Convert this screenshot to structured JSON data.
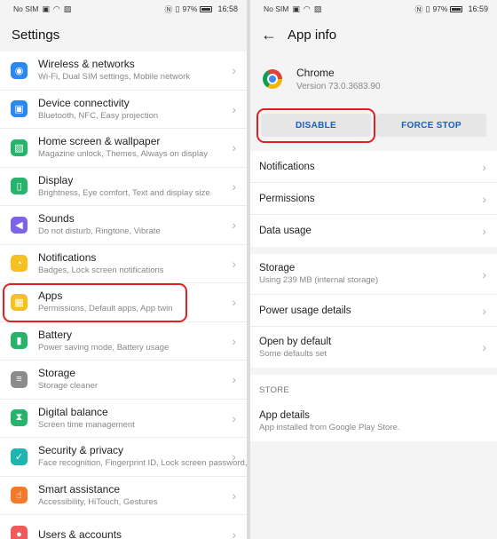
{
  "left": {
    "status": {
      "carrier": "No SIM",
      "battery": "97%",
      "time": "16:58"
    },
    "title": "Settings",
    "items": [
      {
        "title": "Wireless & networks",
        "sub": "Wi-Fi, Dual SIM settings, Mobile network",
        "icon": "wifi-icon",
        "glyph": "◉",
        "color": "#2b88ee"
      },
      {
        "title": "Device connectivity",
        "sub": "Bluetooth, NFC, Easy projection",
        "icon": "device-connectivity-icon",
        "glyph": "▣",
        "color": "#2b88ee"
      },
      {
        "title": "Home screen & wallpaper",
        "sub": "Magazine unlock, Themes, Always on display",
        "icon": "home-screen-icon",
        "glyph": "▧",
        "color": "#27b36b"
      },
      {
        "title": "Display",
        "sub": "Brightness, Eye comfort, Text and display size",
        "icon": "display-icon",
        "glyph": "▯",
        "color": "#27b36b"
      },
      {
        "title": "Sounds",
        "sub": "Do not disturb, Ringtone, Vibrate",
        "icon": "sound-icon",
        "glyph": "◀",
        "color": "#7e63e6"
      },
      {
        "title": "Notifications",
        "sub": "Badges, Lock screen notifications",
        "icon": "bell-icon",
        "glyph": "◔",
        "color": "#f5c021"
      },
      {
        "title": "Apps",
        "sub": "Permissions, Default apps, App twin",
        "icon": "apps-icon",
        "glyph": "▦",
        "color": "#f5c021"
      },
      {
        "title": "Battery",
        "sub": "Power saving mode, Battery usage",
        "icon": "battery-icon",
        "glyph": "▮",
        "color": "#27b36b"
      },
      {
        "title": "Storage",
        "sub": "Storage cleaner",
        "icon": "storage-icon",
        "glyph": "≡",
        "color": "#8c8c8c"
      },
      {
        "title": "Digital balance",
        "sub": "Screen time management",
        "icon": "hourglass-icon",
        "glyph": "⧗",
        "color": "#27b36b"
      },
      {
        "title": "Security & privacy",
        "sub": "Face recognition, Fingerprint ID, Lock screen password, Password vault",
        "icon": "shield-icon",
        "glyph": "✓",
        "color": "#1fb4b0"
      },
      {
        "title": "Smart assistance",
        "sub": "Accessibility, HiTouch, Gestures",
        "icon": "hand-icon",
        "glyph": "☝",
        "color": "#f5792a"
      },
      {
        "title": "Users & accounts",
        "sub": "",
        "icon": "user-icon",
        "glyph": "●",
        "color": "#f05a5a"
      }
    ]
  },
  "right": {
    "status": {
      "carrier": "No SIM",
      "battery": "97%",
      "time": "16:59"
    },
    "title": "App info",
    "app": {
      "name": "Chrome",
      "version": "Version 73.0.3683.90"
    },
    "buttons": {
      "disable": "DISABLE",
      "force_stop": "FORCE STOP"
    },
    "group1": [
      "Notifications",
      "Permissions",
      "Data usage"
    ],
    "group2": [
      {
        "title": "Storage",
        "sub": "Using 239 MB (internal storage)"
      },
      {
        "title": "Power usage details",
        "sub": ""
      },
      {
        "title": "Open by default",
        "sub": "Some defaults set"
      }
    ],
    "store_label": "STORE",
    "store_item": {
      "title": "App details",
      "sub": "App installed from Google Play Store."
    }
  }
}
